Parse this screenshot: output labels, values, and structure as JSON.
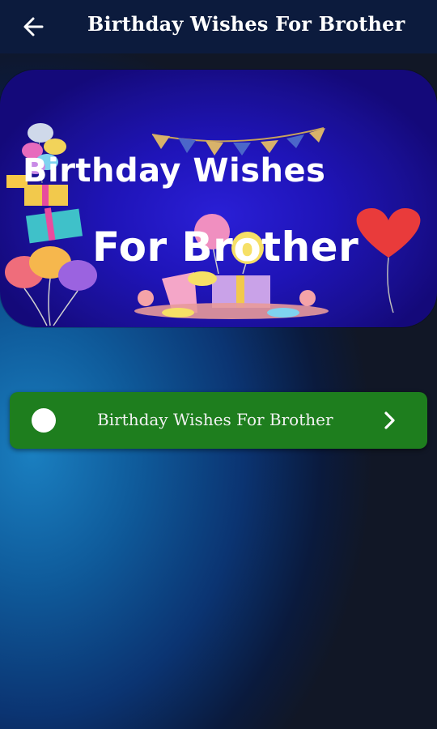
{
  "header": {
    "title": "Birthday Wishes For Brother",
    "back_icon": "arrow-left-icon"
  },
  "banner": {
    "line1": "Birthday Wishes",
    "line2": "For Brother"
  },
  "list": {
    "items": [
      {
        "label": "Birthday Wishes For Brother",
        "icon": "chevron-right-icon"
      }
    ]
  },
  "colors": {
    "appbar": "#0c1b3d",
    "list_item": "#1e7e1e",
    "banner": "#1f14b8"
  }
}
